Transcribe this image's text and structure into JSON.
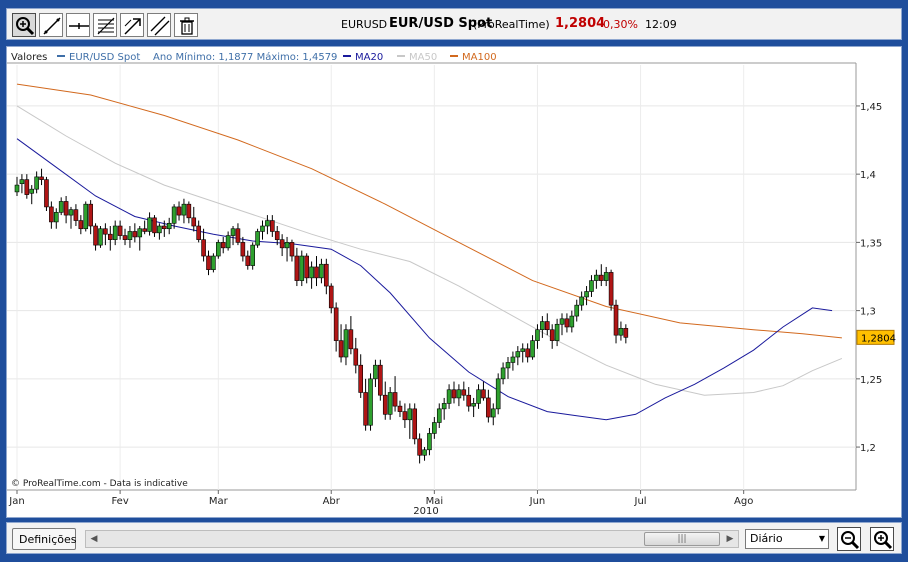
{
  "toolbar": {
    "tools": [
      {
        "name": "zoom-tool",
        "icon": "magnifier-icon",
        "active": true
      },
      {
        "name": "line-tool",
        "icon": "diagonal-line-icon",
        "active": false
      },
      {
        "name": "horizontal-line-tool",
        "icon": "horizontal-line-icon",
        "active": false
      },
      {
        "name": "fibonacci-tool",
        "icon": "fibonacci-icon",
        "active": false
      },
      {
        "name": "arrow-tool",
        "icon": "arrow-icon",
        "active": false
      },
      {
        "name": "channel-tool",
        "icon": "channel-icon",
        "active": false
      },
      {
        "name": "delete-tool",
        "icon": "trash-icon",
        "active": false
      }
    ],
    "symbol": "EURUSD",
    "instrument": "EUR/USD Spot",
    "source": "(ProRealTime)",
    "price": "1,2804",
    "change": "-0,30%",
    "time": "12:09"
  },
  "legend": {
    "label": "Valores",
    "series_name": "EUR/USD Spot",
    "range_text": "Ano Mínimo: 1,1877 Máximo: 1,4579",
    "ma20": "MA20",
    "ma50": "MA50",
    "ma100": "MA100"
  },
  "colors": {
    "up": "#2ea02e",
    "down": "#b01515",
    "ma20": "#1a1a9c",
    "ma50": "#c8c8c8",
    "ma100": "#d2691e",
    "price_tag_bg": "#ffc000",
    "price_positive": "#c00000"
  },
  "watermark": "© ProRealTime.com - Data is indicative",
  "bottombar": {
    "settings_label": "Definições",
    "period_value": "Diário",
    "scroll_thumb_grip": "|||"
  },
  "chart_data": {
    "type": "candlestick",
    "yticks": [
      "1,2",
      "1,25",
      "1,3",
      "1,35",
      "1,4",
      "1,45"
    ],
    "ylim": [
      1.17,
      1.48
    ],
    "xticks": [
      "Jan",
      "Fev",
      "Mar",
      "Abr",
      "Mai",
      "Jun",
      "Jul",
      "Ago"
    ],
    "xtick_positions": [
      0,
      21,
      41,
      64,
      85,
      106,
      127,
      148
    ],
    "year_label": "2010",
    "last_price_label": "1,2804",
    "last_price": 1.2804,
    "grid": true,
    "candles": [
      [
        1.387,
        1.398,
        1.384,
        1.392
      ],
      [
        1.393,
        1.4,
        1.386,
        1.396
      ],
      [
        1.396,
        1.4,
        1.382,
        1.385
      ],
      [
        1.386,
        1.392,
        1.378,
        1.389
      ],
      [
        1.389,
        1.402,
        1.386,
        1.398
      ],
      [
        1.398,
        1.404,
        1.392,
        1.396
      ],
      [
        1.396,
        1.398,
        1.373,
        1.376
      ],
      [
        1.376,
        1.38,
        1.36,
        1.365
      ],
      [
        1.365,
        1.375,
        1.36,
        1.372
      ],
      [
        1.372,
        1.383,
        1.37,
        1.38
      ],
      [
        1.38,
        1.384,
        1.364,
        1.37
      ],
      [
        1.37,
        1.376,
        1.36,
        1.374
      ],
      [
        1.374,
        1.378,
        1.362,
        1.366
      ],
      [
        1.366,
        1.37,
        1.356,
        1.36
      ],
      [
        1.36,
        1.38,
        1.358,
        1.378
      ],
      [
        1.378,
        1.381,
        1.356,
        1.362
      ],
      [
        1.362,
        1.364,
        1.344,
        1.348
      ],
      [
        1.348,
        1.362,
        1.346,
        1.36
      ],
      [
        1.36,
        1.364,
        1.348,
        1.356
      ],
      [
        1.356,
        1.362,
        1.344,
        1.352
      ],
      [
        1.352,
        1.366,
        1.348,
        1.362
      ],
      [
        1.362,
        1.366,
        1.352,
        1.355
      ],
      [
        1.355,
        1.36,
        1.348,
        1.352
      ],
      [
        1.352,
        1.362,
        1.346,
        1.358
      ],
      [
        1.358,
        1.364,
        1.35,
        1.354
      ],
      [
        1.354,
        1.362,
        1.344,
        1.36
      ],
      [
        1.36,
        1.366,
        1.356,
        1.358
      ],
      [
        1.358,
        1.372,
        1.355,
        1.368
      ],
      [
        1.368,
        1.37,
        1.354,
        1.357
      ],
      [
        1.357,
        1.364,
        1.352,
        1.362
      ],
      [
        1.362,
        1.366,
        1.354,
        1.36
      ],
      [
        1.36,
        1.368,
        1.356,
        1.364
      ],
      [
        1.364,
        1.378,
        1.36,
        1.376
      ],
      [
        1.376,
        1.38,
        1.366,
        1.37
      ],
      [
        1.37,
        1.382,
        1.364,
        1.378
      ],
      [
        1.378,
        1.38,
        1.364,
        1.368
      ],
      [
        1.368,
        1.376,
        1.358,
        1.362
      ],
      [
        1.362,
        1.366,
        1.35,
        1.352
      ],
      [
        1.352,
        1.36,
        1.336,
        1.34
      ],
      [
        1.34,
        1.344,
        1.326,
        1.33
      ],
      [
        1.33,
        1.342,
        1.328,
        1.34
      ],
      [
        1.34,
        1.352,
        1.338,
        1.35
      ],
      [
        1.35,
        1.354,
        1.342,
        1.346
      ],
      [
        1.346,
        1.358,
        1.344,
        1.355
      ],
      [
        1.355,
        1.362,
        1.348,
        1.36
      ],
      [
        1.36,
        1.364,
        1.348,
        1.35
      ],
      [
        1.35,
        1.354,
        1.336,
        1.34
      ],
      [
        1.34,
        1.344,
        1.33,
        1.333
      ],
      [
        1.333,
        1.35,
        1.33,
        1.348
      ],
      [
        1.348,
        1.36,
        1.346,
        1.358
      ],
      [
        1.358,
        1.366,
        1.352,
        1.362
      ],
      [
        1.362,
        1.37,
        1.356,
        1.366
      ],
      [
        1.366,
        1.37,
        1.354,
        1.358
      ],
      [
        1.358,
        1.362,
        1.348,
        1.352
      ],
      [
        1.352,
        1.356,
        1.34,
        1.346
      ],
      [
        1.346,
        1.354,
        1.336,
        1.35
      ],
      [
        1.35,
        1.352,
        1.336,
        1.34
      ],
      [
        1.34,
        1.346,
        1.318,
        1.322
      ],
      [
        1.322,
        1.344,
        1.318,
        1.34
      ],
      [
        1.34,
        1.342,
        1.32,
        1.324
      ],
      [
        1.324,
        1.336,
        1.316,
        1.332
      ],
      [
        1.332,
        1.34,
        1.318,
        1.324
      ],
      [
        1.324,
        1.338,
        1.32,
        1.334
      ],
      [
        1.334,
        1.338,
        1.312,
        1.318
      ],
      [
        1.318,
        1.32,
        1.298,
        1.302
      ],
      [
        1.302,
        1.306,
        1.27,
        1.278
      ],
      [
        1.278,
        1.29,
        1.262,
        1.266
      ],
      [
        1.266,
        1.29,
        1.26,
        1.286
      ],
      [
        1.286,
        1.296,
        1.268,
        1.272
      ],
      [
        1.272,
        1.28,
        1.254,
        1.26
      ],
      [
        1.26,
        1.268,
        1.236,
        1.24
      ],
      [
        1.24,
        1.25,
        1.212,
        1.216
      ],
      [
        1.216,
        1.254,
        1.212,
        1.25
      ],
      [
        1.25,
        1.264,
        1.244,
        1.26
      ],
      [
        1.26,
        1.264,
        1.234,
        1.238
      ],
      [
        1.238,
        1.248,
        1.22,
        1.224
      ],
      [
        1.224,
        1.244,
        1.22,
        1.24
      ],
      [
        1.24,
        1.252,
        1.226,
        1.23
      ],
      [
        1.23,
        1.234,
        1.222,
        1.226
      ],
      [
        1.226,
        1.232,
        1.214,
        1.22
      ],
      [
        1.22,
        1.232,
        1.206,
        1.228
      ],
      [
        1.228,
        1.232,
        1.202,
        1.206
      ],
      [
        1.206,
        1.21,
        1.188,
        1.194
      ],
      [
        1.194,
        1.2,
        1.19,
        1.198
      ],
      [
        1.198,
        1.214,
        1.194,
        1.21
      ],
      [
        1.21,
        1.222,
        1.206,
        1.218
      ],
      [
        1.218,
        1.232,
        1.214,
        1.228
      ],
      [
        1.228,
        1.236,
        1.22,
        1.232
      ],
      [
        1.232,
        1.246,
        1.228,
        1.242
      ],
      [
        1.242,
        1.248,
        1.232,
        1.236
      ],
      [
        1.236,
        1.246,
        1.23,
        1.242
      ],
      [
        1.242,
        1.248,
        1.234,
        1.238
      ],
      [
        1.238,
        1.244,
        1.226,
        1.23
      ],
      [
        1.23,
        1.236,
        1.222,
        1.232
      ],
      [
        1.232,
        1.246,
        1.228,
        1.242
      ],
      [
        1.242,
        1.248,
        1.234,
        1.236
      ],
      [
        1.236,
        1.242,
        1.218,
        1.222
      ],
      [
        1.222,
        1.232,
        1.216,
        1.228
      ],
      [
        1.228,
        1.254,
        1.224,
        1.25
      ],
      [
        1.25,
        1.262,
        1.246,
        1.258
      ],
      [
        1.258,
        1.266,
        1.25,
        1.262
      ],
      [
        1.262,
        1.27,
        1.256,
        1.266
      ],
      [
        1.266,
        1.274,
        1.26,
        1.27
      ],
      [
        1.27,
        1.276,
        1.262,
        1.272
      ],
      [
        1.272,
        1.276,
        1.262,
        1.266
      ],
      [
        1.266,
        1.282,
        1.264,
        1.278
      ],
      [
        1.278,
        1.29,
        1.272,
        1.286
      ],
      [
        1.286,
        1.296,
        1.28,
        1.292
      ],
      [
        1.292,
        1.298,
        1.282,
        1.286
      ],
      [
        1.286,
        1.29,
        1.272,
        1.278
      ],
      [
        1.278,
        1.294,
        1.274,
        1.29
      ],
      [
        1.29,
        1.298,
        1.282,
        1.294
      ],
      [
        1.294,
        1.298,
        1.284,
        1.288
      ],
      [
        1.288,
        1.3,
        1.284,
        1.296
      ],
      [
        1.296,
        1.308,
        1.292,
        1.304
      ],
      [
        1.304,
        1.314,
        1.3,
        1.31
      ],
      [
        1.31,
        1.318,
        1.304,
        1.314
      ],
      [
        1.314,
        1.326,
        1.31,
        1.322
      ],
      [
        1.322,
        1.33,
        1.316,
        1.326
      ],
      [
        1.326,
        1.334,
        1.318,
        1.322
      ],
      [
        1.322,
        1.332,
        1.318,
        1.328
      ],
      [
        1.328,
        1.33,
        1.3,
        1.304
      ],
      [
        1.304,
        1.308,
        1.276,
        1.282
      ],
      [
        1.282,
        1.292,
        1.278,
        1.287
      ],
      [
        1.287,
        1.29,
        1.276,
        1.2804
      ]
    ],
    "ma20": [
      [
        0,
        1.426
      ],
      [
        8,
        1.405
      ],
      [
        16,
        1.384
      ],
      [
        24,
        1.369
      ],
      [
        32,
        1.362
      ],
      [
        40,
        1.356
      ],
      [
        48,
        1.351
      ],
      [
        56,
        1.349
      ],
      [
        64,
        1.345
      ],
      [
        70,
        1.333
      ],
      [
        76,
        1.313
      ],
      [
        84,
        1.28
      ],
      [
        92,
        1.255
      ],
      [
        100,
        1.237
      ],
      [
        108,
        1.226
      ],
      [
        114,
        1.223
      ],
      [
        120,
        1.22
      ],
      [
        126,
        1.224
      ],
      [
        132,
        1.236
      ],
      [
        138,
        1.246
      ],
      [
        144,
        1.258
      ],
      [
        150,
        1.271
      ],
      [
        156,
        1.288
      ],
      [
        162,
        1.302
      ],
      [
        166,
        1.3
      ]
    ],
    "ma50": [
      [
        0,
        1.45
      ],
      [
        10,
        1.428
      ],
      [
        20,
        1.408
      ],
      [
        30,
        1.392
      ],
      [
        40,
        1.38
      ],
      [
        50,
        1.368
      ],
      [
        60,
        1.356
      ],
      [
        70,
        1.345
      ],
      [
        80,
        1.336
      ],
      [
        90,
        1.318
      ],
      [
        100,
        1.298
      ],
      [
        110,
        1.278
      ],
      [
        120,
        1.26
      ],
      [
        130,
        1.246
      ],
      [
        140,
        1.238
      ],
      [
        150,
        1.24
      ],
      [
        156,
        1.245
      ],
      [
        162,
        1.256
      ],
      [
        168,
        1.265
      ]
    ],
    "ma100": [
      [
        0,
        1.466
      ],
      [
        15,
        1.458
      ],
      [
        30,
        1.443
      ],
      [
        45,
        1.425
      ],
      [
        60,
        1.404
      ],
      [
        75,
        1.378
      ],
      [
        90,
        1.35
      ],
      [
        105,
        1.322
      ],
      [
        120,
        1.303
      ],
      [
        135,
        1.291
      ],
      [
        150,
        1.286
      ],
      [
        160,
        1.283
      ],
      [
        168,
        1.28
      ]
    ]
  }
}
